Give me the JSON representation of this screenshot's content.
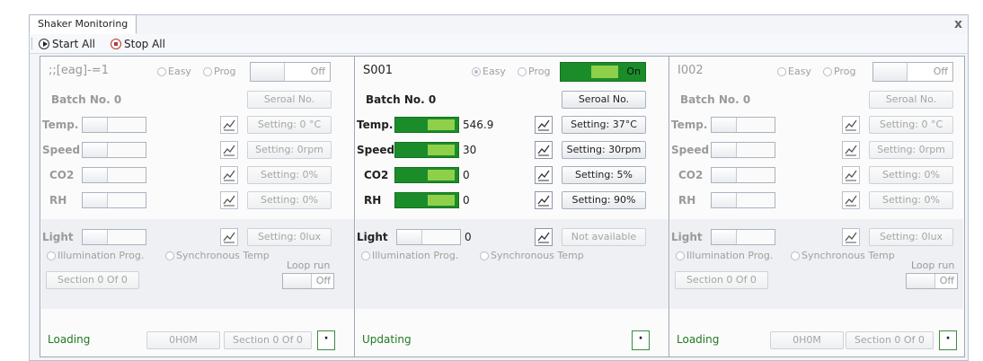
{
  "window": {
    "tab_title": "Shaker Monitoring",
    "close_glyph": "x"
  },
  "toolbar": {
    "start_all": "Start All",
    "stop_all": "Stop All"
  },
  "units": [
    {
      "name": ";;[eag]-=1",
      "active": false,
      "mode_easy": "Easy",
      "mode_prog": "Prog",
      "power_label": "Off",
      "batch": "Batch No. 0",
      "seroal": "Seroal No.",
      "params": [
        {
          "label": "Temp.",
          "value": "",
          "setting": "Setting: 0 °C"
        },
        {
          "label": "Speed",
          "value": "",
          "setting": "Setting: 0rpm"
        },
        {
          "label": "CO2",
          "value": "",
          "setting": "Setting: 0%"
        },
        {
          "label": "RH",
          "value": "",
          "setting": "Setting: 0%"
        }
      ],
      "light": {
        "label": "Light",
        "value": "",
        "setting": "Setting: 0lux"
      },
      "illum_prog": "Illumination Prog.",
      "sync_temp": "Synchronous Temp",
      "loop_run": "Loop run",
      "loop_state": "Off",
      "section": "Section 0 Of 0",
      "status": "Loading",
      "time": "0H0M",
      "section_footer": "Section 0 Of 0"
    },
    {
      "name": "S001",
      "active": true,
      "mode_easy": "Easy",
      "mode_prog": "Prog",
      "power_label": "On",
      "batch": "Batch No. 0",
      "seroal": "Seroal No.",
      "params": [
        {
          "label": "Temp.",
          "value": "546.9",
          "setting": "Setting: 37°C"
        },
        {
          "label": "Speed",
          "value": "30",
          "setting": "Setting: 30rpm"
        },
        {
          "label": "CO2",
          "value": "0",
          "setting": "Setting: 5%"
        },
        {
          "label": "RH",
          "value": "0",
          "setting": "Setting: 90%"
        }
      ],
      "light": {
        "label": "Light",
        "value": "0",
        "setting": "Not available"
      },
      "illum_prog": "Illumination Prog.",
      "sync_temp": "Synchronous Temp",
      "status": "Updating"
    },
    {
      "name": "I002",
      "active": false,
      "mode_easy": "Easy",
      "mode_prog": "Prog",
      "power_label": "Off",
      "batch": "Batch No. 0",
      "seroal": "Seroal No.",
      "params": [
        {
          "label": "Temp.",
          "value": "",
          "setting": "Setting: 0 °C"
        },
        {
          "label": "Speed",
          "value": "",
          "setting": "Setting: 0rpm"
        },
        {
          "label": "CO2",
          "value": "",
          "setting": "Setting: 0%"
        },
        {
          "label": "RH",
          "value": "",
          "setting": "Setting: 0%"
        }
      ],
      "light": {
        "label": "Light",
        "value": "",
        "setting": "Setting: 0lux"
      },
      "illum_prog": "Illumination Prog.",
      "sync_temp": "Synchronous Temp",
      "loop_run": "Loop run",
      "loop_state": "Off",
      "section": "Section 0 Of 0",
      "status": "Loading",
      "time": "0H0M",
      "section_footer": "Section 0 Of 0"
    }
  ],
  "dot_glyph": "·",
  "colors": {
    "on_green": "#1b8c2a",
    "knob_green": "#8fd04a",
    "status_green": "#1f7a1f"
  }
}
